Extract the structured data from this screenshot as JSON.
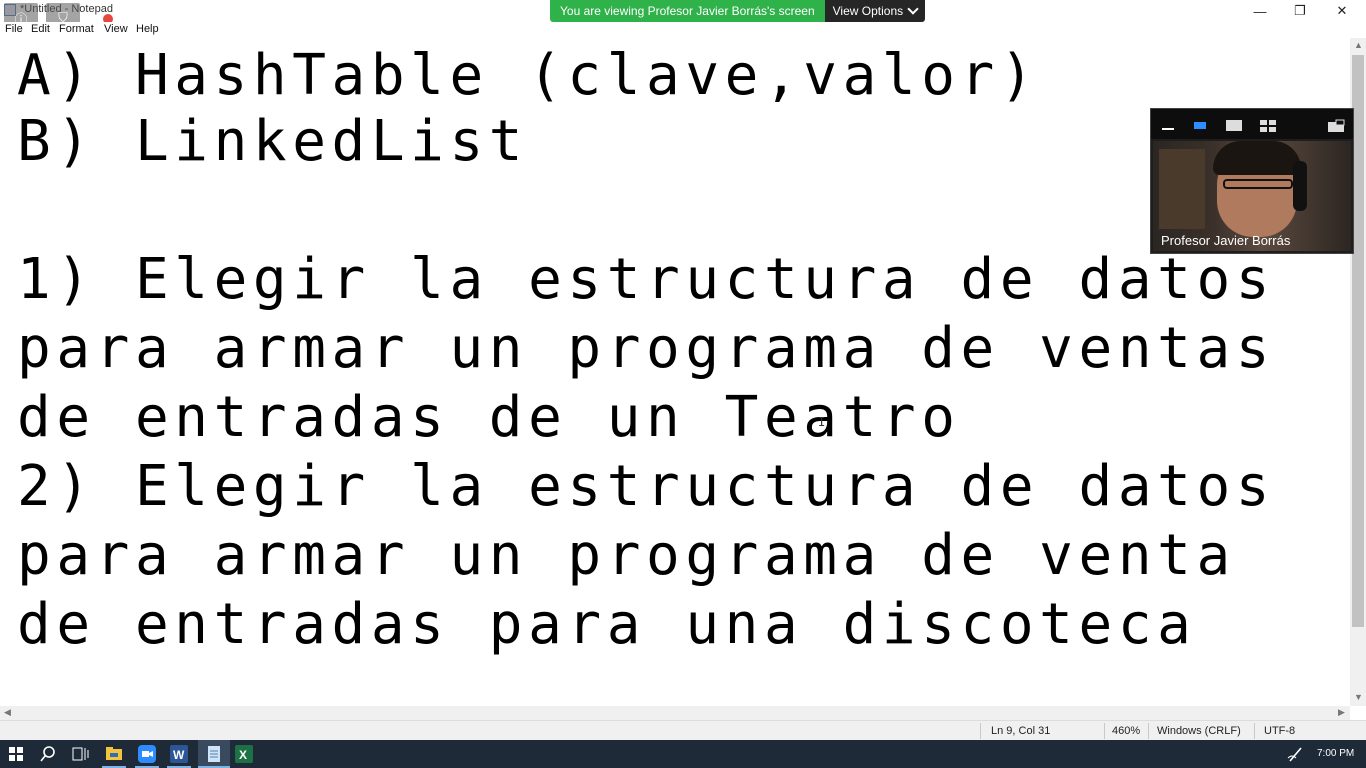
{
  "window": {
    "title": "*Untitled - Notepad",
    "controls": {
      "minimize": "—",
      "maximize": "❐",
      "close": "✕"
    }
  },
  "zoom_banner": {
    "text": "You are viewing Profesor Javier Borrás's screen",
    "button": "View Options"
  },
  "menu": [
    "File",
    "Edit",
    "Format",
    "View",
    "Help"
  ],
  "editor": {
    "lines": [
      "A) HashTable (clave,valor)",
      "B) LinkedList",
      "",
      "1) Elegir la estructura de datos",
      "para armar un programa de ventas",
      "de entradas de un Teatro",
      "2) Elegir la estructura de datos",
      "para armar un programa de venta",
      "de entradas para una discoteca"
    ]
  },
  "status": {
    "position": "Ln 9, Col 31",
    "zoom": "460%",
    "line_endings": "Windows (CRLF)",
    "encoding": "UTF-8"
  },
  "video": {
    "participant": "Profesor Javier Borrás"
  },
  "taskbar": {
    "time": "7:00 PM",
    "accent": "#7fb2e5"
  },
  "colors": {
    "banner_green": "#2fb24a",
    "banner_dark": "#262626",
    "taskbar": "#1e2a38"
  }
}
